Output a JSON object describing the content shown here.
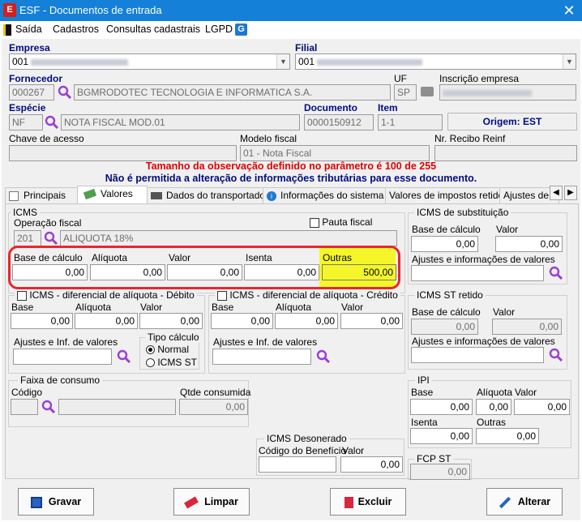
{
  "window": {
    "title": "ESF - Documentos de entrada",
    "close": "✕"
  },
  "menu": [
    "Saída",
    "Cadastros",
    "Consultas cadastrais",
    "LGPD"
  ],
  "empresa": {
    "label": "Empresa",
    "value": "001"
  },
  "filial": {
    "label": "Filial",
    "value": "001"
  },
  "fornecedor": {
    "label": "Fornecedor",
    "code": "000267",
    "name": "BGMRODOTEC TECNOLOGIA E INFORMATICA S.A."
  },
  "uf": {
    "label": "UF",
    "value": "SP"
  },
  "inscricao": {
    "label": "Inscrição empresa"
  },
  "especie": {
    "label": "Espécie",
    "code": "NF",
    "name": "NOTA FISCAL MOD.01"
  },
  "documento": {
    "label": "Documento",
    "value": "0000150912"
  },
  "item": {
    "label": "Item",
    "value": "1-1"
  },
  "origem": "Origem: EST",
  "chave": {
    "label": "Chave de acesso"
  },
  "modelo": {
    "label": "Modelo fiscal",
    "value": "01 - Nota Fiscal"
  },
  "recibo": {
    "label": "Nr. Recibo Reinf"
  },
  "warnings": [
    "Tamanho da observação definido no parâmetro é 100 de 255",
    "Não é permitida a alteração de informações tributárias para esse documento."
  ],
  "tabs": [
    "Principais",
    "Valores",
    "Dados do transportador",
    "Informações do sistema",
    "Valores de impostos retidos",
    "Ajustes de C"
  ],
  "icms": {
    "title": "ICMS",
    "op_label": "Operação fiscal",
    "op_code": "201",
    "op_name": "ALIQUOTA 18%",
    "pauta": "Pauta fiscal",
    "base_label": "Base de cálculo",
    "base": "0,00",
    "aliq_label": "Alíquota",
    "aliq": "0,00",
    "valor_label": "Valor",
    "valor": "0,00",
    "isenta_label": "Isenta",
    "isenta": "0,00",
    "outras_label": "Outras",
    "outras": "500,00"
  },
  "difal_debito": {
    "title": "ICMS - diferencial de alíquota - Débito",
    "base_label": "Base",
    "base": "0,00",
    "aliq_label": "Alíquota",
    "aliq": "0,00",
    "valor_label": "Valor",
    "valor": "0,00",
    "ajustes_label": "Ajustes e Inf. de valores",
    "tipo_label": "Tipo cálculo",
    "tipo_normal": "Normal",
    "tipo_st": "ICMS ST"
  },
  "difal_credito": {
    "title": "ICMS - diferencial de alíquota - Crédito",
    "base_label": "Base",
    "base": "0,00",
    "aliq_label": "Alíquota",
    "aliq": "0,00",
    "valor_label": "Valor",
    "valor": "0,00",
    "ajustes_label": "Ajustes e Inf. de valores"
  },
  "st": {
    "title": "ICMS de substituição",
    "base_label": "Base de cálculo",
    "base": "0,00",
    "valor_label": "Valor",
    "valor": "0,00",
    "ajustes_label": "Ajustes e informações de valores"
  },
  "st_retido": {
    "title": "ICMS ST retido",
    "base_label": "Base de cálculo",
    "base": "0,00",
    "valor_label": "Valor",
    "valor": "0,00",
    "ajustes_label": "Ajustes e informações de valores"
  },
  "faixa": {
    "title": "Faixa de consumo",
    "codigo_label": "Código",
    "qtde_label": "Qtde consumida",
    "qtde": "0,00"
  },
  "ipi": {
    "title": "IPI",
    "base_label": "Base",
    "base": "0,00",
    "aliq_label": "Alíquota",
    "aliq": "0,00",
    "valor_label": "Valor",
    "valor": "0,00",
    "isenta_label": "Isenta",
    "isenta": "0,00",
    "outras_label": "Outras",
    "outras": "0,00"
  },
  "desonerado": {
    "title": "ICMS Desonerado",
    "cod_label": "Código do Benefício",
    "valor_label": "Valor",
    "valor": "0,00"
  },
  "fcp_st": {
    "title": "FCP ST",
    "valor": "0,00"
  },
  "buttons": {
    "gravar": "Gravar",
    "limpar": "Limpar",
    "excluir": "Excluir",
    "alterar": "Alterar"
  },
  "colors": {
    "titlebar": "#1480d8",
    "highlight": "#f4f62a",
    "ring": "#e8262e",
    "label_blue": "#000c80",
    "warning_red": "#e00000",
    "warning_blue": "#000c80"
  }
}
